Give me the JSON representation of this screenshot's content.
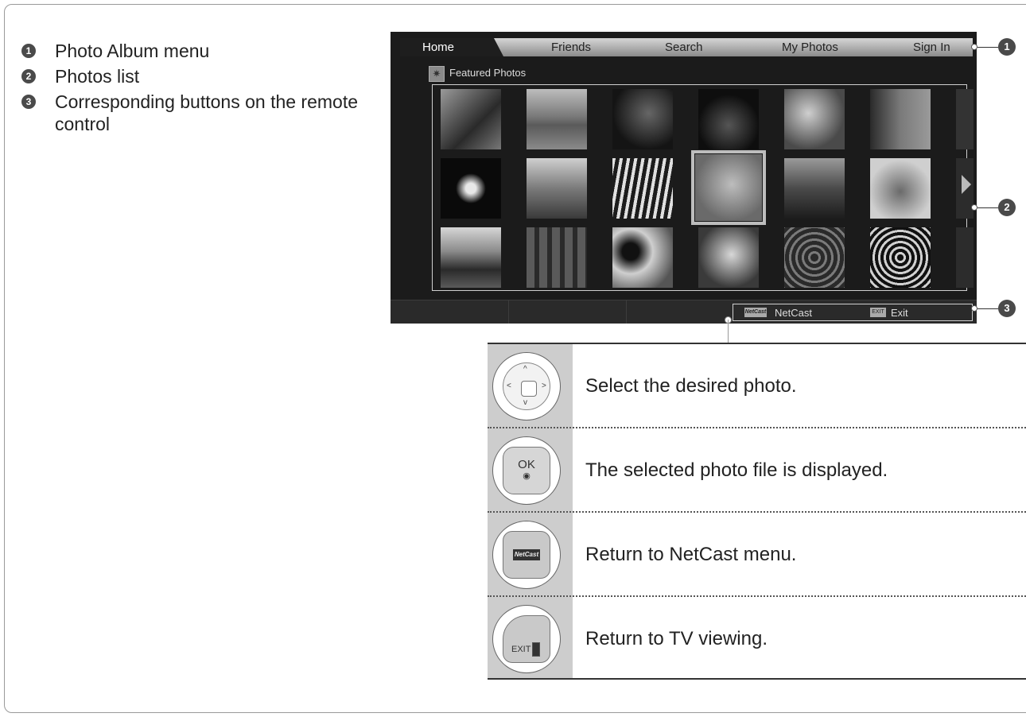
{
  "legend": [
    {
      "num": "1",
      "text": "Photo Album menu"
    },
    {
      "num": "2",
      "text": "Photos list"
    },
    {
      "num": "3",
      "text": "Corresponding buttons on the remote control"
    }
  ],
  "screen": {
    "tabs": {
      "home": "Home",
      "friends": "Friends",
      "search": "Search",
      "my_photos": "My Photos",
      "sign_in": "Sign In"
    },
    "section_title": "Featured Photos",
    "bottom": {
      "netcast_key": "NetCast",
      "netcast_label": "NetCast",
      "exit_key": "EXIT",
      "exit_label": "Exit"
    }
  },
  "callouts": [
    "1",
    "2",
    "3"
  ],
  "buttons": {
    "dpad": {
      "text": "Select the desired photo."
    },
    "ok": {
      "key": "OK",
      "text": "The selected photo file is displayed."
    },
    "netcast": {
      "key": "NetCast",
      "text": "Return to NetCast menu."
    },
    "exit": {
      "key": "EXIT",
      "text": "Return to TV viewing."
    }
  }
}
